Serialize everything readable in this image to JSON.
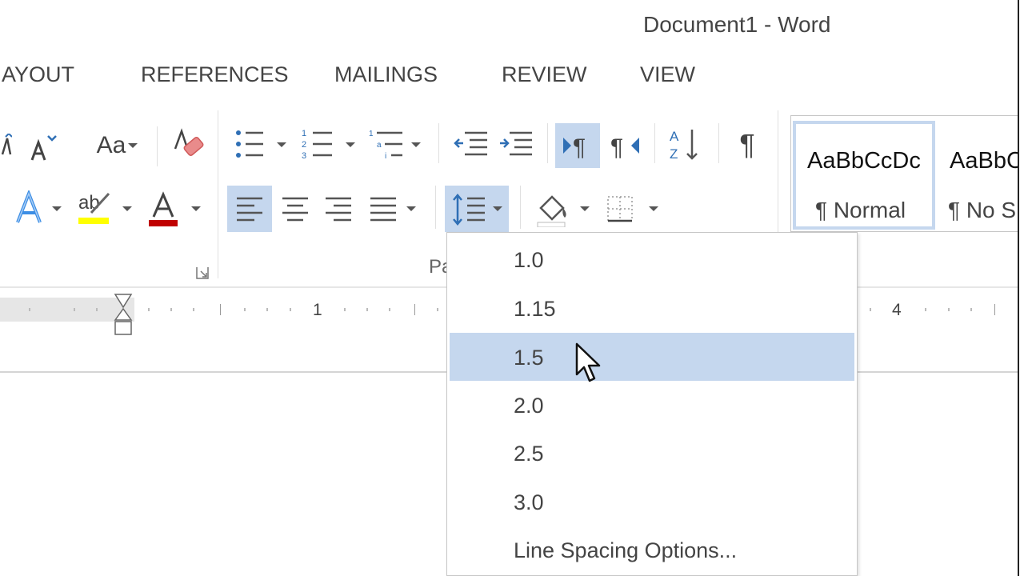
{
  "window": {
    "title": "Document1 - Word"
  },
  "tabs": [
    {
      "id": "layout",
      "label": "AYOUT"
    },
    {
      "id": "references",
      "label": "REFERENCES"
    },
    {
      "id": "mailings",
      "label": "MAILINGS"
    },
    {
      "id": "review",
      "label": "REVIEW"
    },
    {
      "id": "view",
      "label": "VIEW"
    }
  ],
  "font_group": {
    "change_case_label": "Aa",
    "text_highlight_label": "ab"
  },
  "paragraph_group": {
    "label": "Pa"
  },
  "styles": [
    {
      "sample": "AaBbCcDc",
      "name": "¶ Normal"
    },
    {
      "sample": "AaBbC",
      "name": "¶ No Sp"
    }
  ],
  "ruler": {
    "numbers": [
      "1",
      "4"
    ]
  },
  "line_spacing_menu": {
    "items": [
      {
        "label": "1.0",
        "hovered": false
      },
      {
        "label": "1.15",
        "hovered": false
      },
      {
        "label": "1.5",
        "hovered": true
      },
      {
        "label": "2.0",
        "hovered": false
      },
      {
        "label": "2.5",
        "hovered": false
      },
      {
        "label": "3.0",
        "hovered": false
      }
    ],
    "options_label": "Line Spacing Options..."
  },
  "colors": {
    "selected_bg": "#c5d7ee",
    "highlight_yellow": "#ffff00",
    "font_color_red": "#c00000",
    "text_effects_blue": "#3c8ee5",
    "icon_blue": "#2f6fb5"
  }
}
